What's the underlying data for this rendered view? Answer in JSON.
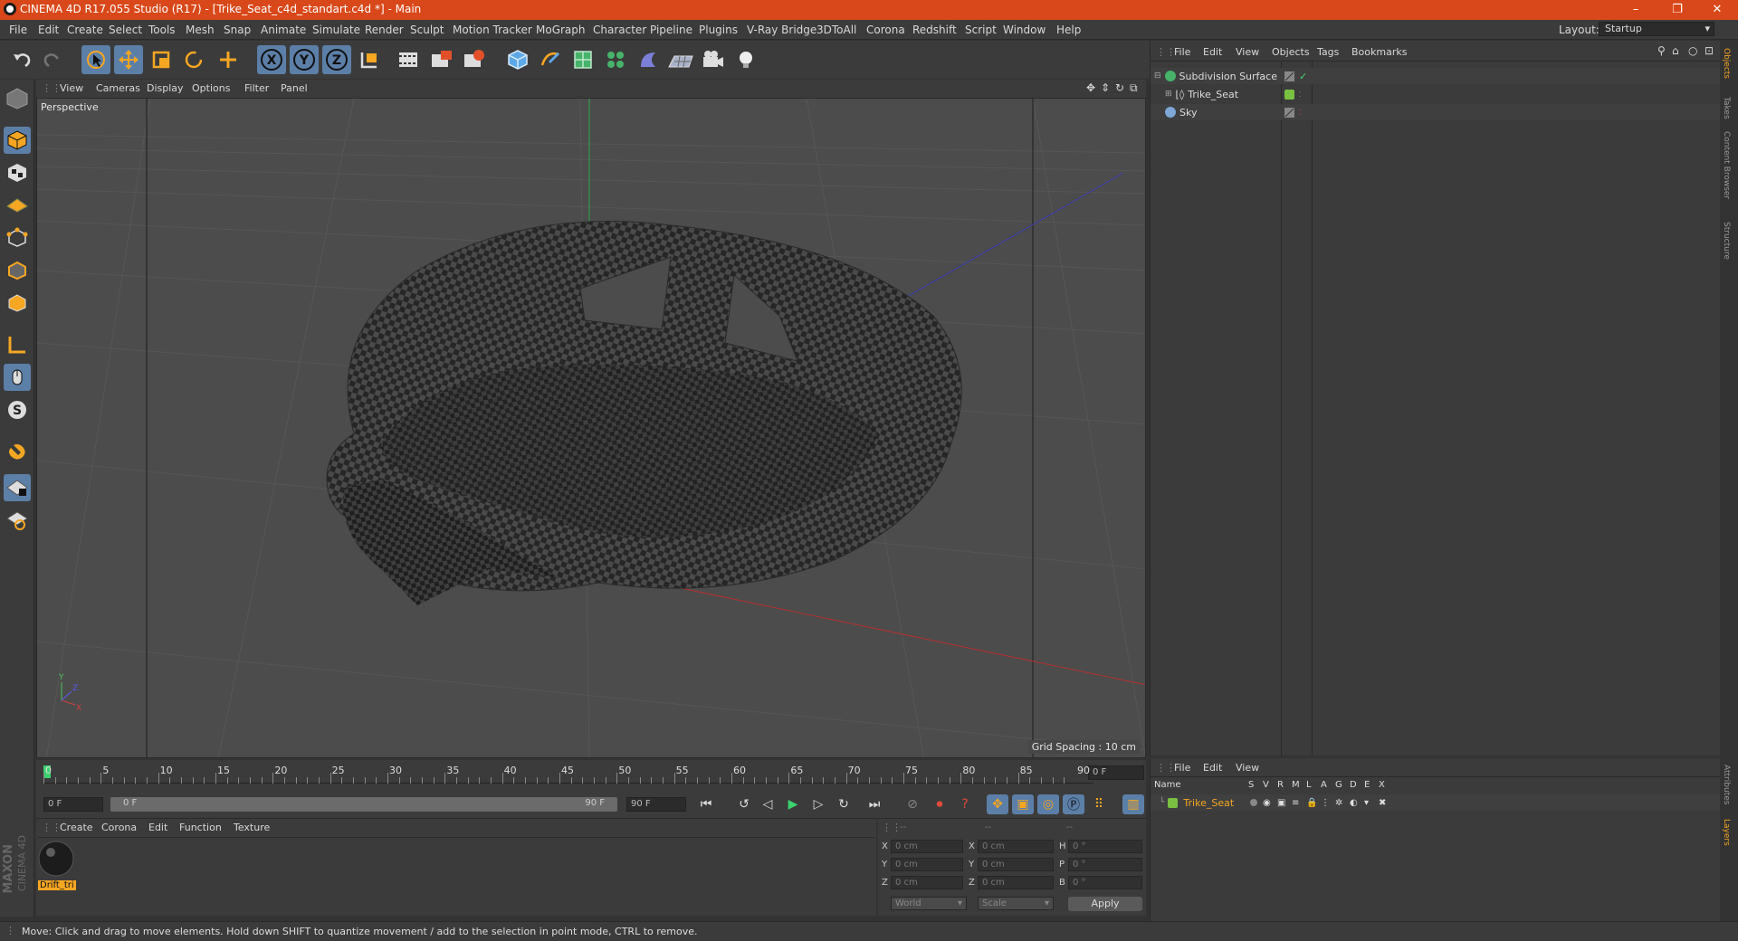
{
  "window": {
    "title": "CINEMA 4D R17.055 Studio (R17) - [Trike_Seat_c4d_standart.c4d *] - Main",
    "controls": [
      "–",
      "❐",
      "✕"
    ]
  },
  "menu": [
    "File",
    "Edit",
    "Create",
    "Select",
    "Tools",
    "Mesh",
    "Snap",
    "Animate",
    "Simulate",
    "Render",
    "Sculpt",
    "Motion Tracker",
    "MoGraph",
    "Character",
    "Pipeline",
    "Plugins",
    "V-Ray Bridge",
    "3DToAll",
    "Corona",
    "Redshift",
    "Script",
    "Window",
    "Help"
  ],
  "layout": {
    "label": "Layout:",
    "value": "Startup"
  },
  "toolbar": {
    "icons": [
      "undo-icon",
      "redo-icon",
      "select-arrow-icon",
      "move-icon",
      "scale-icon",
      "rotate-icon",
      "move-plus-icon",
      "x-axis-icon",
      "y-axis-icon",
      "z-axis-icon",
      "coordinate-system-icon",
      "render-view-icon",
      "render-picture-viewer-icon",
      "edit-render-settings-icon",
      "cube-icon",
      "pen-spline-icon",
      "subdivision-icon",
      "cloner-icon",
      "deformer-icon",
      "floor-icon",
      "camera-icon",
      "light-icon"
    ],
    "axis_labels": [
      "X",
      "Y",
      "Z"
    ]
  },
  "left_tools": [
    "make-editable-icon",
    "model-mode-icon",
    "texture-mode-icon",
    "workplane-icon",
    "points-mode-icon",
    "edges-mode-icon",
    "polygons-mode-icon",
    "axis-mode-icon",
    "tweak-icon",
    "snap-icon",
    "magnet-icon",
    "lock-workplane-icon",
    "grid-workplane-icon"
  ],
  "viewport": {
    "menu": [
      "View",
      "Cameras",
      "Display",
      "Options",
      "Filter",
      "Panel"
    ],
    "label": "Perspective",
    "grid_spacing": "Grid Spacing : 10 cm"
  },
  "timeline": {
    "ticks": [
      "0",
      "5",
      "10",
      "15",
      "20",
      "25",
      "30",
      "35",
      "40",
      "45",
      "50",
      "55",
      "60",
      "65",
      "70",
      "75",
      "80",
      "85",
      "90"
    ],
    "current_frame": "0 F",
    "start": "0 F",
    "range_start": "0 F",
    "range_end": "90 F",
    "end": "90 F"
  },
  "materials": {
    "menu": [
      "Create",
      "Corona",
      "Edit",
      "Function",
      "Texture"
    ],
    "items": [
      {
        "name": "Drift_tri"
      }
    ]
  },
  "coordinates": {
    "headers": [
      "--",
      "--",
      "--"
    ],
    "rows": [
      {
        "a": "X",
        "av": "0 cm",
        "b": "X",
        "bv": "0 cm",
        "c": "H",
        "cv": "0 °"
      },
      {
        "a": "Y",
        "av": "0 cm",
        "b": "Y",
        "bv": "0 cm",
        "c": "P",
        "cv": "0 °"
      },
      {
        "a": "Z",
        "av": "0 cm",
        "b": "Z",
        "bv": "0 cm",
        "c": "B",
        "cv": "0 °"
      }
    ],
    "mode1": "World",
    "mode2": "Scale",
    "apply": "Apply"
  },
  "objects": {
    "menu": [
      "File",
      "Edit",
      "View",
      "Objects",
      "Tags",
      "Bookmarks"
    ],
    "items": [
      {
        "name": "Subdivision Surface",
        "indent": 0
      },
      {
        "name": "Trike_Seat",
        "indent": 1
      },
      {
        "name": "Sky",
        "indent": 0
      }
    ]
  },
  "layers": {
    "menu": [
      "File",
      "Edit",
      "View"
    ],
    "columns": [
      "Name",
      "S",
      "V",
      "R",
      "M",
      "L",
      "A",
      "G",
      "D",
      "E",
      "X"
    ],
    "items": [
      {
        "name": "Trike_Seat"
      }
    ]
  },
  "right_tabs": [
    "Objects",
    "Takes",
    "Content Browser",
    "Structure"
  ],
  "right_tabs_bottom": [
    "Attributes",
    "Layers"
  ],
  "status": "Move: Click and drag to move elements. Hold down SHIFT to quantize movement / add to the selection in point mode, CTRL to remove.",
  "brand": [
    "MAXON",
    "CINEMA 4D"
  ],
  "colors": {
    "accent": "#d9481a",
    "selected": "#5c7fa8",
    "layer_green": "#7ac142",
    "highlight": "#f5a623"
  }
}
